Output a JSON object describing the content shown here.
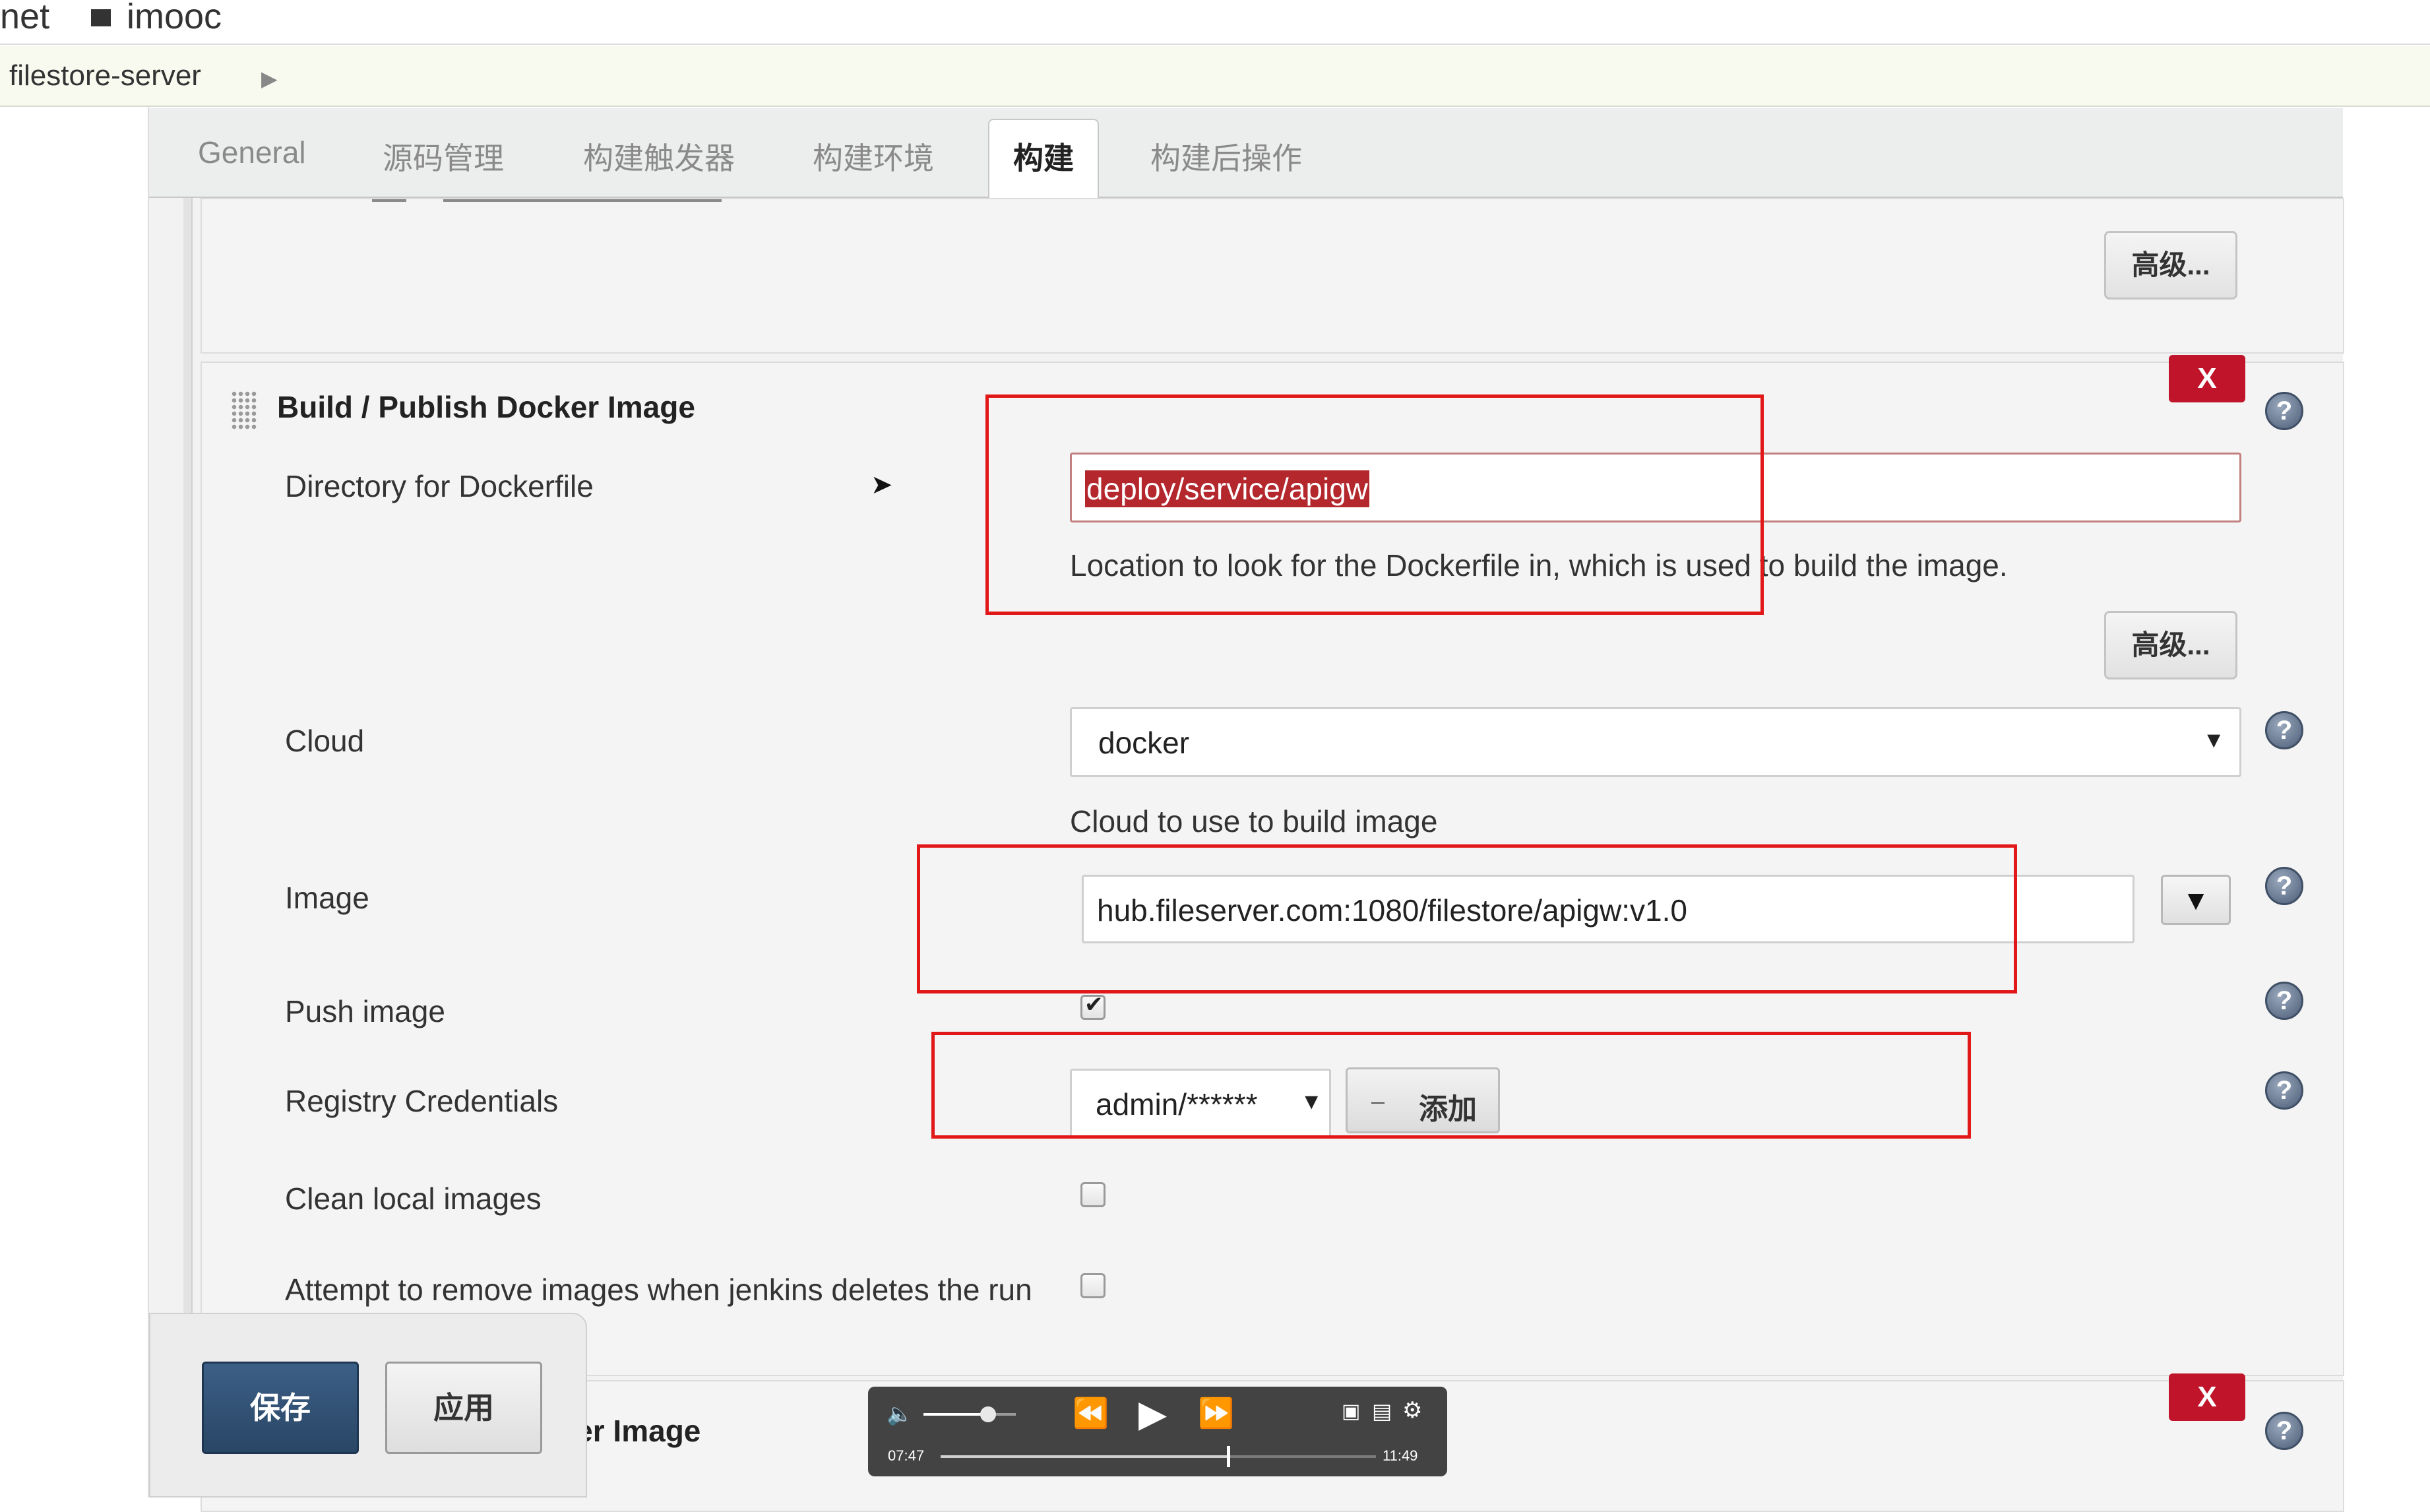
{
  "topbar": {
    "left_text": "net",
    "right_text": "imooc"
  },
  "breadcrumb": {
    "project": "filestore-server"
  },
  "tabs": [
    {
      "label": "General",
      "active": false
    },
    {
      "label": "源码管理",
      "active": false
    },
    {
      "label": "构建触发器",
      "active": false
    },
    {
      "label": "构建环境",
      "active": false
    },
    {
      "label": "构建",
      "active": true
    },
    {
      "label": "构建后操作",
      "active": false
    }
  ],
  "advanced_label": "高级...",
  "remove_label": "X",
  "help_glyph": "?",
  "section": {
    "title": "Build / Publish Docker Image",
    "dockerfile": {
      "label": "Directory for Dockerfile",
      "value": "deploy/service/apigw",
      "hint": "Location to look for the Dockerfile in, which is used to build the image."
    },
    "cloud": {
      "label": "Cloud",
      "value": "docker",
      "hint": "Cloud to use to build image"
    },
    "image": {
      "label": "Image",
      "value": "hub.fileserver.com:1080/filestore/apigw:v1.0"
    },
    "push_image": {
      "label": "Push image",
      "checked": true
    },
    "registry_credentials": {
      "label": "Registry Credentials",
      "value": "admin/******",
      "add_label": "添加"
    },
    "clean_local_images": {
      "label": "Clean local images",
      "checked": false
    },
    "remove_on_delete": {
      "label": "Attempt to remove images when jenkins deletes the run",
      "checked": false
    }
  },
  "next_section_title_partial": "cker Image",
  "next_section_slash": "/",
  "footer": {
    "save_label": "保存",
    "apply_label": "应用"
  },
  "player": {
    "elapsed": "07:47",
    "duration": "11:49",
    "progress_fraction": 0.66,
    "volume_fraction": 0.7
  },
  "colors": {
    "highlight_red": "#e21818",
    "save_blue": "#2f4e70",
    "remove_red": "#c0142a",
    "selection_red": "#b3272d"
  }
}
